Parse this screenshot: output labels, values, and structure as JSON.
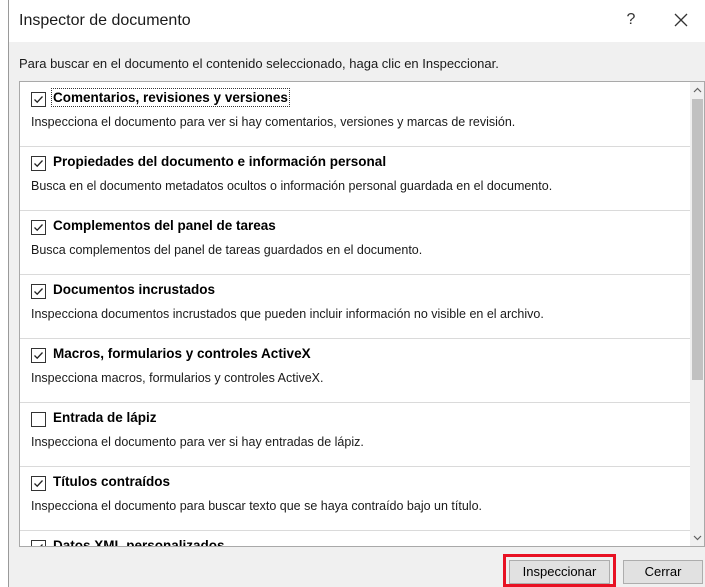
{
  "window": {
    "title": "Inspector de documento",
    "help_label": "?",
    "close_icon": "close-icon"
  },
  "instructions": "Para buscar en el documento el contenido seleccionado, haga clic en Inspeccionar.",
  "items": [
    {
      "title": "Comentarios, revisiones y versiones",
      "description": "Inspecciona el documento para ver si hay comentarios, versiones y marcas de revisión.",
      "checked": true
    },
    {
      "title": "Propiedades del documento e información personal",
      "description": "Busca en el documento metadatos ocultos o información personal guardada en el documento.",
      "checked": true
    },
    {
      "title": "Complementos del panel de tareas",
      "description": "Busca complementos del panel de tareas guardados en el documento.",
      "checked": true
    },
    {
      "title": "Documentos incrustados",
      "description": "Inspecciona documentos incrustados que pueden incluir información no visible en el archivo.",
      "checked": true
    },
    {
      "title": "Macros, formularios y controles ActiveX",
      "description": "Inspecciona macros, formularios y controles ActiveX.",
      "checked": true
    },
    {
      "title": "Entrada de lápiz",
      "description": "Inspecciona el documento para ver si hay entradas de lápiz.",
      "checked": false
    },
    {
      "title": "Títulos contraídos",
      "description": "Inspecciona el documento para buscar texto que se haya contraído bajo un título.",
      "checked": true
    },
    {
      "title": "Datos XML personalizados",
      "description": "",
      "checked": true
    }
  ],
  "buttons": {
    "inspect_label": "Inspeccionar",
    "close_label": "Cerrar"
  },
  "colors": {
    "highlight": "#e81123",
    "dialog_bg": "#f0f0f0"
  }
}
